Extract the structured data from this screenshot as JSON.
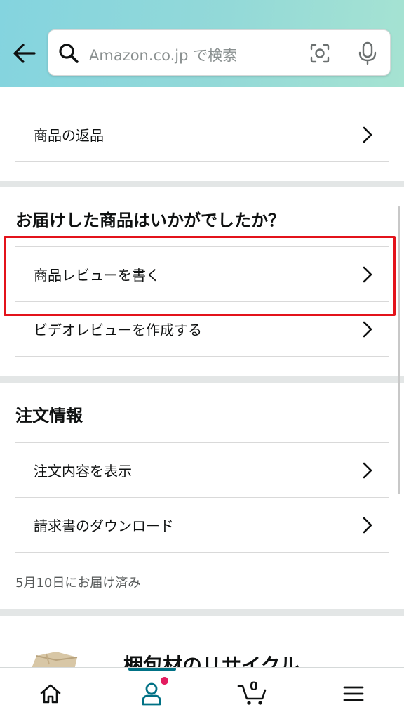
{
  "header": {
    "search_placeholder": "Amazon.co.jp で検索"
  },
  "returns": {
    "item_label": "商品の返品"
  },
  "review_section": {
    "title": "お届けした商品はいかがでしたか？",
    "items": [
      {
        "label": "商品レビューを書く"
      },
      {
        "label": "ビデオレビューを作成する"
      }
    ]
  },
  "order_info": {
    "title": "注文情報",
    "items": [
      {
        "label": "注文内容を表示"
      },
      {
        "label": "請求書のダウンロード"
      }
    ],
    "delivery_status": "5月10日にお届け済み"
  },
  "recycle": {
    "title": "梱包材のリサイクル"
  },
  "bottom_nav": {
    "items": [
      {
        "icon": "home-icon"
      },
      {
        "icon": "account-icon"
      },
      {
        "icon": "cart-icon"
      },
      {
        "icon": "menu-icon"
      }
    ],
    "cart_count": "0",
    "active_index": 1
  },
  "colors": {
    "accent": "#007185",
    "highlight": "#e3131b",
    "badge": "#e31c5f"
  }
}
